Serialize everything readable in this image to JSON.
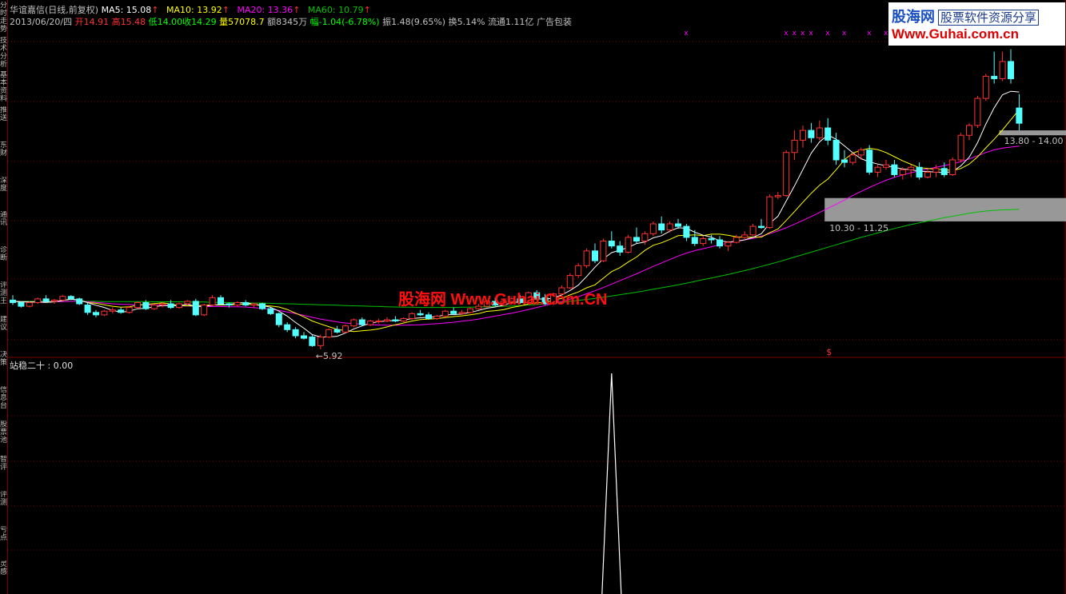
{
  "sidebar": {
    "tabs": [
      "分时走势",
      "技术分析",
      "基本资料",
      "推送",
      "东财",
      "深度",
      "通讯",
      "诊断",
      "评测王",
      "建议",
      "决策",
      "信息台",
      "股票池",
      "智评",
      "评测",
      "亏点",
      "灵感"
    ]
  },
  "header": {
    "stock_name": "华谊嘉信(日线,前复权)",
    "ma5_label": "MA5: 15.08",
    "ma10_label": "MA10: 13.92",
    "ma20_label": "MA20: 13.36",
    "ma60_label": "MA60: 10.79",
    "arrow": "↑",
    "date": "2013/06/20/四",
    "open": "开14.91",
    "high": "高15.48",
    "low": "低14.00",
    "close": "收14.29",
    "volume": "量57078.7",
    "amount": "额8345万",
    "change": "幅-1.04(-6.78%)",
    "amplitude": "振1.48(9.65%)",
    "turnover": "换5.14%",
    "float_cap": "流通1.11亿",
    "ad": "广告包装"
  },
  "logo": {
    "brand": "股海网",
    "slogan": "股票软件资源分享",
    "url": "Www.Guhai.com.cn"
  },
  "watermark": "股海网 Www.Guhai.Com.CN",
  "indicator": {
    "label": "站稳二十 : 0.00"
  },
  "colors": {
    "bg": "#000000",
    "up": "#ff3232",
    "down": "#54ffff",
    "ma5": "#ffffff",
    "ma10": "#ffff00",
    "ma20": "#ff00ff",
    "ma60": "#00c000",
    "grid": "#800000",
    "marker": "#ff00ff",
    "zone": "#a0a0a0"
  },
  "chart_data": [
    {
      "type": "candlestick",
      "ylim": [
        5,
        18
      ],
      "annotations": {
        "low_label": "←5.92",
        "zone_low": "10.30 - 11.25",
        "zone_high": "13.80 - 14.00",
        "signal": "$",
        "marker": "x"
      },
      "candles": [
        [
          7.1,
          7.3,
          6.9,
          7.0
        ],
        [
          7.0,
          7.05,
          6.8,
          6.85
        ],
        [
          6.85,
          7.05,
          6.8,
          7.0
        ],
        [
          7.0,
          7.2,
          6.95,
          7.15
        ],
        [
          7.15,
          7.3,
          7.0,
          7.05
        ],
        [
          7.05,
          7.15,
          6.95,
          7.1
        ],
        [
          7.1,
          7.3,
          7.05,
          7.25
        ],
        [
          7.25,
          7.3,
          7.1,
          7.15
        ],
        [
          7.15,
          7.2,
          6.9,
          6.95
        ],
        [
          6.9,
          7.0,
          6.5,
          6.6
        ],
        [
          6.6,
          6.7,
          6.4,
          6.5
        ],
        [
          6.5,
          6.7,
          6.45,
          6.65
        ],
        [
          6.65,
          6.8,
          6.55,
          6.7
        ],
        [
          6.7,
          6.8,
          6.55,
          6.6
        ],
        [
          6.6,
          6.85,
          6.55,
          6.8
        ],
        [
          6.8,
          7.05,
          6.75,
          7.0
        ],
        [
          7.0,
          7.1,
          6.7,
          6.75
        ],
        [
          6.75,
          6.95,
          6.7,
          6.9
        ],
        [
          6.9,
          7.0,
          6.8,
          6.95
        ],
        [
          6.95,
          7.1,
          6.75,
          6.8
        ],
        [
          6.8,
          7.0,
          6.75,
          6.95
        ],
        [
          6.95,
          7.1,
          6.9,
          7.05
        ],
        [
          7.05,
          7.15,
          6.45,
          6.5
        ],
        [
          6.5,
          6.95,
          6.45,
          6.9
        ],
        [
          6.9,
          7.3,
          6.85,
          7.2
        ],
        [
          7.2,
          7.3,
          6.9,
          6.95
        ],
        [
          6.95,
          7.0,
          6.8,
          6.9
        ],
        [
          6.9,
          7.05,
          6.85,
          7.0
        ],
        [
          7.0,
          7.1,
          6.85,
          6.9
        ],
        [
          6.9,
          7.0,
          6.8,
          6.95
        ],
        [
          6.95,
          7.0,
          6.7,
          6.75
        ],
        [
          6.75,
          6.8,
          6.5,
          6.55
        ],
        [
          6.55,
          6.6,
          6.0,
          6.1
        ],
        [
          6.1,
          6.2,
          5.8,
          5.9
        ],
        [
          5.9,
          6.0,
          5.55,
          5.65
        ],
        [
          5.65,
          5.8,
          5.5,
          5.55
        ],
        [
          5.6,
          5.7,
          5.2,
          5.25
        ],
        [
          5.25,
          5.7,
          5.1,
          5.6
        ],
        [
          5.6,
          5.95,
          5.55,
          5.9
        ],
        [
          5.9,
          6.05,
          5.75,
          5.8
        ],
        [
          5.8,
          6.1,
          5.75,
          6.05
        ],
        [
          6.05,
          6.35,
          6.0,
          6.3
        ],
        [
          6.3,
          6.4,
          6.05,
          6.1
        ],
        [
          6.1,
          6.3,
          6.05,
          6.25
        ],
        [
          6.25,
          6.35,
          6.15,
          6.25
        ],
        [
          6.25,
          6.4,
          6.2,
          6.3
        ],
        [
          6.3,
          6.45,
          6.2,
          6.25
        ],
        [
          6.25,
          6.4,
          6.2,
          6.35
        ],
        [
          6.35,
          6.6,
          6.3,
          6.55
        ],
        [
          6.55,
          6.7,
          6.45,
          6.5
        ],
        [
          6.5,
          6.6,
          6.3,
          6.35
        ],
        [
          6.35,
          6.5,
          6.3,
          6.45
        ],
        [
          6.45,
          6.7,
          6.4,
          6.65
        ],
        [
          6.65,
          6.8,
          6.5,
          6.55
        ],
        [
          6.55,
          6.7,
          6.5,
          6.6
        ],
        [
          6.6,
          6.8,
          6.55,
          6.75
        ],
        [
          6.75,
          6.95,
          6.7,
          6.85
        ],
        [
          6.85,
          7.1,
          6.8,
          7.05
        ],
        [
          7.05,
          7.2,
          6.85,
          6.9
        ],
        [
          6.9,
          7.1,
          6.85,
          7.05
        ],
        [
          7.05,
          7.25,
          6.95,
          7.15
        ],
        [
          7.15,
          7.3,
          6.95,
          7.0
        ],
        [
          7.0,
          7.45,
          6.95,
          7.4
        ],
        [
          7.4,
          7.5,
          7.1,
          7.2
        ],
        [
          7.2,
          7.35,
          6.9,
          6.95
        ],
        [
          6.95,
          7.4,
          6.9,
          7.35
        ],
        [
          7.35,
          7.7,
          7.3,
          7.6
        ],
        [
          7.6,
          8.2,
          7.55,
          8.1
        ],
        [
          8.1,
          8.6,
          8.0,
          8.5
        ],
        [
          8.5,
          9.2,
          8.4,
          9.1
        ],
        [
          9.1,
          9.4,
          8.6,
          8.7
        ],
        [
          8.7,
          9.6,
          8.65,
          9.5
        ],
        [
          9.5,
          9.9,
          9.2,
          9.3
        ],
        [
          9.3,
          9.5,
          8.9,
          9.05
        ],
        [
          9.05,
          9.75,
          9.0,
          9.65
        ],
        [
          9.65,
          10.05,
          9.4,
          9.5
        ],
        [
          9.5,
          9.9,
          9.35,
          9.8
        ],
        [
          9.8,
          10.3,
          9.7,
          10.2
        ],
        [
          10.2,
          10.5,
          9.8,
          9.95
        ],
        [
          9.95,
          10.3,
          9.85,
          10.2
        ],
        [
          10.2,
          10.4,
          10.0,
          10.1
        ],
        [
          10.1,
          10.2,
          9.5,
          9.65
        ],
        [
          9.65,
          9.95,
          9.3,
          9.4
        ],
        [
          9.4,
          9.7,
          9.3,
          9.6
        ],
        [
          9.6,
          9.75,
          9.4,
          9.55
        ],
        [
          9.55,
          9.7,
          9.2,
          9.3
        ],
        [
          9.3,
          9.5,
          9.1,
          9.45
        ],
        [
          9.45,
          9.75,
          9.4,
          9.65
        ],
        [
          9.65,
          9.9,
          9.55,
          9.75
        ],
        [
          9.75,
          10.2,
          9.7,
          10.1
        ],
        [
          10.1,
          10.4,
          10.0,
          10.05
        ],
        [
          10.05,
          11.4,
          10.0,
          11.3
        ],
        [
          11.3,
          11.5,
          11.2,
          11.35
        ],
        [
          11.35,
          13.2,
          11.3,
          13.1
        ],
        [
          13.1,
          14.0,
          12.8,
          13.6
        ],
        [
          13.6,
          14.2,
          13.3,
          14.0
        ],
        [
          14.0,
          14.3,
          13.5,
          13.7
        ],
        [
          13.7,
          14.4,
          13.6,
          14.1
        ],
        [
          14.1,
          14.5,
          13.4,
          13.6
        ],
        [
          13.6,
          13.9,
          12.6,
          12.8
        ],
        [
          12.8,
          13.2,
          12.5,
          12.7
        ],
        [
          12.7,
          13.1,
          12.6,
          13.0
        ],
        [
          13.0,
          13.3,
          12.8,
          13.2
        ],
        [
          13.2,
          13.4,
          12.2,
          12.3
        ],
        [
          12.3,
          12.6,
          12.1,
          12.5
        ],
        [
          12.5,
          12.8,
          12.4,
          12.6
        ],
        [
          12.6,
          12.8,
          12.1,
          12.2
        ],
        [
          12.2,
          12.5,
          12.0,
          12.4
        ],
        [
          12.4,
          12.6,
          12.1,
          12.5
        ],
        [
          12.5,
          12.7,
          12.0,
          12.1
        ],
        [
          12.1,
          12.4,
          12.05,
          12.3
        ],
        [
          12.3,
          12.6,
          12.1,
          12.45
        ],
        [
          12.45,
          12.7,
          12.1,
          12.2
        ],
        [
          12.2,
          12.9,
          12.15,
          12.8
        ],
        [
          12.8,
          13.9,
          12.7,
          13.8
        ],
        [
          13.8,
          14.3,
          13.6,
          14.2
        ],
        [
          14.2,
          15.4,
          14.1,
          15.3
        ],
        [
          15.3,
          16.3,
          15.2,
          16.2
        ],
        [
          16.2,
          17.2,
          15.9,
          16.1
        ],
        [
          16.1,
          17.2,
          16.0,
          16.8
        ],
        [
          16.8,
          17.3,
          15.9,
          16.1
        ],
        [
          14.91,
          15.48,
          14.0,
          14.29
        ]
      ],
      "ma5": [
        7.05,
        7.03,
        7.02,
        7.02,
        7.01,
        7.03,
        7.09,
        7.14,
        7.1,
        7.0,
        6.89,
        6.8,
        6.68,
        6.61,
        6.65,
        6.75,
        6.77,
        6.83,
        6.88,
        6.88,
        6.88,
        6.93,
        6.85,
        6.84,
        6.89,
        6.92,
        6.91,
        6.99,
        6.99,
        6.94,
        6.88,
        6.81,
        6.65,
        6.45,
        6.19,
        5.96,
        5.7,
        5.6,
        5.6,
        5.63,
        5.76,
        5.93,
        6.05,
        6.16,
        6.23,
        6.25,
        6.27,
        6.29,
        6.35,
        6.38,
        6.4,
        6.43,
        6.5,
        6.51,
        6.53,
        6.6,
        6.68,
        6.77,
        6.82,
        6.89,
        7.0,
        7.03,
        7.12,
        7.15,
        7.14,
        7.18,
        7.31,
        7.49,
        7.71,
        8.06,
        8.44,
        8.78,
        9.03,
        9.13,
        9.24,
        9.4,
        9.46,
        9.63,
        9.72,
        9.9,
        10.04,
        10.02,
        9.86,
        9.74,
        9.66,
        9.51,
        9.46,
        9.49,
        9.55,
        9.65,
        9.8,
        10.22,
        10.51,
        11.13,
        11.75,
        12.41,
        13.07,
        13.53,
        13.81,
        13.64,
        13.37,
        13.09,
        12.85,
        12.72,
        12.63,
        12.56,
        12.5,
        12.43,
        12.4,
        12.34,
        12.33,
        12.3,
        12.28,
        12.33,
        12.56,
        12.91,
        13.5,
        14.26,
        14.92,
        15.45,
        15.59,
        15.56
      ],
      "ma10": [
        7.05,
        7.03,
        7.02,
        7.02,
        7.01,
        7.03,
        7.09,
        7.14,
        7.1,
        7.0,
        6.97,
        6.91,
        6.85,
        6.81,
        6.83,
        6.89,
        6.93,
        6.96,
        6.99,
        6.94,
        6.88,
        6.87,
        6.86,
        6.89,
        6.91,
        6.9,
        6.9,
        6.92,
        6.94,
        6.91,
        6.88,
        6.86,
        6.82,
        6.72,
        6.57,
        6.42,
        6.25,
        6.13,
        6.02,
        5.91,
        5.86,
        5.82,
        5.85,
        5.88,
        5.93,
        6.01,
        6.1,
        6.17,
        6.25,
        6.31,
        6.33,
        6.35,
        6.39,
        6.43,
        6.46,
        6.5,
        6.55,
        6.64,
        6.67,
        6.71,
        6.8,
        6.86,
        6.94,
        6.99,
        7.01,
        7.09,
        7.17,
        7.31,
        7.43,
        7.6,
        7.72,
        7.99,
        8.26,
        8.42,
        8.65,
        8.85,
        9.12,
        9.33,
        9.43,
        9.57,
        9.72,
        9.74,
        9.75,
        9.72,
        9.78,
        9.78,
        9.74,
        9.67,
        9.65,
        9.66,
        9.66,
        9.84,
        9.99,
        10.34,
        10.7,
        11.08,
        11.44,
        11.77,
        12.02,
        12.4,
        12.81,
        13.08,
        13.19,
        13.27,
        13.22,
        13.1,
        12.93,
        12.76,
        12.62,
        12.48,
        12.45,
        12.42,
        12.4,
        12.37,
        12.45,
        12.63,
        12.92,
        13.29,
        13.64,
        14.02,
        14.43,
        14.84
      ],
      "ma20": [
        7.05,
        7.04,
        7.03,
        7.03,
        7.03,
        7.03,
        7.04,
        7.05,
        7.05,
        7.03,
        7.01,
        6.98,
        6.95,
        6.93,
        6.92,
        6.91,
        6.91,
        6.91,
        6.91,
        6.89,
        6.87,
        6.86,
        6.85,
        6.84,
        6.84,
        6.84,
        6.83,
        6.83,
        6.82,
        6.79,
        6.76,
        6.73,
        6.68,
        6.62,
        6.55,
        6.48,
        6.4,
        6.33,
        6.27,
        6.21,
        6.17,
        6.14,
        6.12,
        6.1,
        6.09,
        6.08,
        6.08,
        6.08,
        6.09,
        6.1,
        6.12,
        6.14,
        6.17,
        6.2,
        6.24,
        6.28,
        6.33,
        6.39,
        6.45,
        6.51,
        6.57,
        6.64,
        6.72,
        6.8,
        6.88,
        6.96,
        7.04,
        7.14,
        7.24,
        7.36,
        7.48,
        7.61,
        7.75,
        7.89,
        8.03,
        8.17,
        8.32,
        8.47,
        8.61,
        8.75,
        8.89,
        9.01,
        9.11,
        9.19,
        9.27,
        9.35,
        9.42,
        9.49,
        9.55,
        9.61,
        9.7,
        9.8,
        9.91,
        10.04,
        10.19,
        10.34,
        10.5,
        10.66,
        10.83,
        11.0,
        11.17,
        11.35,
        11.52,
        11.68,
        11.83,
        11.97,
        12.09,
        12.19,
        12.28,
        12.35,
        12.43,
        12.5,
        12.57,
        12.64,
        12.73,
        12.84,
        12.97,
        13.1,
        13.21,
        13.28,
        13.32,
        13.36
      ],
      "ma60": [
        7.05,
        7.05,
        7.05,
        7.05,
        7.05,
        7.05,
        7.05,
        7.05,
        7.05,
        7.05,
        7.05,
        7.04,
        7.04,
        7.04,
        7.04,
        7.04,
        7.04,
        7.03,
        7.03,
        7.03,
        7.03,
        7.02,
        7.02,
        7.02,
        7.01,
        7.01,
        7.0,
        7.0,
        6.99,
        6.98,
        6.98,
        6.97,
        6.96,
        6.95,
        6.94,
        6.93,
        6.92,
        6.91,
        6.9,
        6.89,
        6.88,
        6.87,
        6.86,
        6.85,
        6.84,
        6.83,
        6.82,
        6.81,
        6.81,
        6.8,
        6.8,
        6.8,
        6.8,
        6.8,
        6.81,
        6.81,
        6.82,
        6.83,
        6.84,
        6.85,
        6.86,
        6.88,
        6.9,
        6.92,
        6.95,
        6.98,
        7.01,
        7.05,
        7.09,
        7.13,
        7.17,
        7.22,
        7.27,
        7.32,
        7.37,
        7.42,
        7.48,
        7.54,
        7.6,
        7.66,
        7.72,
        7.79,
        7.86,
        7.93,
        8.0,
        8.07,
        8.14,
        8.22,
        8.3,
        8.38,
        8.47,
        8.56,
        8.65,
        8.75,
        8.85,
        8.95,
        9.05,
        9.15,
        9.25,
        9.35,
        9.45,
        9.55,
        9.65,
        9.74,
        9.83,
        9.92,
        10.01,
        10.09,
        10.17,
        10.24,
        10.31,
        10.38,
        10.45,
        10.51,
        10.57,
        10.63,
        10.68,
        10.72,
        10.75,
        10.77,
        10.78,
        10.79
      ],
      "markers_x_candle_index": [
        81,
        93,
        94,
        95,
        96,
        98,
        100,
        103,
        105,
        107,
        108,
        109,
        110
      ],
      "zones": [
        {
          "low": 10.3,
          "high": 11.25
        },
        {
          "low": 13.8,
          "high": 14.0
        }
      ]
    },
    {
      "type": "line",
      "title": "站稳二十 : 0.00",
      "values_nonzero": {
        "candle_index": 72,
        "value": 1
      }
    }
  ]
}
